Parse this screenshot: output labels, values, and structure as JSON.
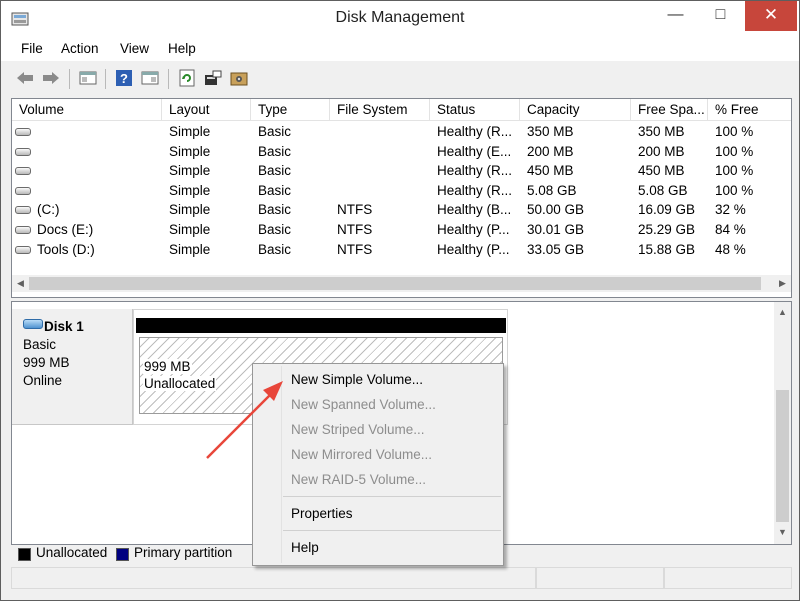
{
  "window": {
    "title": "Disk Management",
    "minimize": "—",
    "maximize": "□",
    "close": "✕"
  },
  "menu": [
    "File",
    "Action",
    "View",
    "Help"
  ],
  "toolbar_icons": [
    "back-arrow-icon",
    "forward-arrow-icon",
    "properties-pane-icon",
    "help-icon",
    "console-tree-icon",
    "refresh-icon",
    "rescan-disks-icon",
    "settings-icon"
  ],
  "volume_table": {
    "columns": [
      "Volume",
      "Layout",
      "Type",
      "File System",
      "Status",
      "Capacity",
      "Free Spa...",
      "% Free"
    ],
    "rows": [
      [
        "",
        "Simple",
        "Basic",
        "",
        "Healthy (R...",
        "350 MB",
        "350 MB",
        "100 %"
      ],
      [
        "",
        "Simple",
        "Basic",
        "",
        "Healthy (E...",
        "200 MB",
        "200 MB",
        "100 %"
      ],
      [
        "",
        "Simple",
        "Basic",
        "",
        "Healthy (R...",
        "450 MB",
        "450 MB",
        "100 %"
      ],
      [
        "",
        "Simple",
        "Basic",
        "",
        "Healthy (R...",
        "5.08 GB",
        "5.08 GB",
        "100 %"
      ],
      [
        "(C:)",
        "Simple",
        "Basic",
        "NTFS",
        "Healthy (B...",
        "50.00 GB",
        "16.09 GB",
        "32 %"
      ],
      [
        "Docs (E:)",
        "Simple",
        "Basic",
        "NTFS",
        "Healthy (P...",
        "30.01 GB",
        "25.29 GB",
        "84 %"
      ],
      [
        "Tools (D:)",
        "Simple",
        "Basic",
        "NTFS",
        "Healthy (P...",
        "33.05 GB",
        "15.88 GB",
        "48 %"
      ]
    ]
  },
  "disk": {
    "name": "Disk 1",
    "type": "Basic",
    "size": "999 MB",
    "status": "Online",
    "partition": {
      "size": "999 MB",
      "label": "Unallocated"
    }
  },
  "legend": [
    {
      "label": "Unallocated",
      "color": "#000000"
    },
    {
      "label": "Primary partition",
      "color": "#000080"
    }
  ],
  "context_menu": {
    "items": [
      {
        "label": "New Simple Volume...",
        "enabled": true
      },
      {
        "label": "New Spanned Volume...",
        "enabled": false
      },
      {
        "label": "New Striped Volume...",
        "enabled": false
      },
      {
        "label": "New Mirrored Volume...",
        "enabled": false
      },
      {
        "label": "New RAID-5 Volume...",
        "enabled": false
      },
      {
        "label": "Properties",
        "enabled": true
      },
      {
        "label": "Help",
        "enabled": true
      }
    ]
  },
  "colors": {
    "close_button": "#c7463b",
    "annotation_arrow": "#e8463a",
    "disk_icon": "#4f93d1"
  }
}
